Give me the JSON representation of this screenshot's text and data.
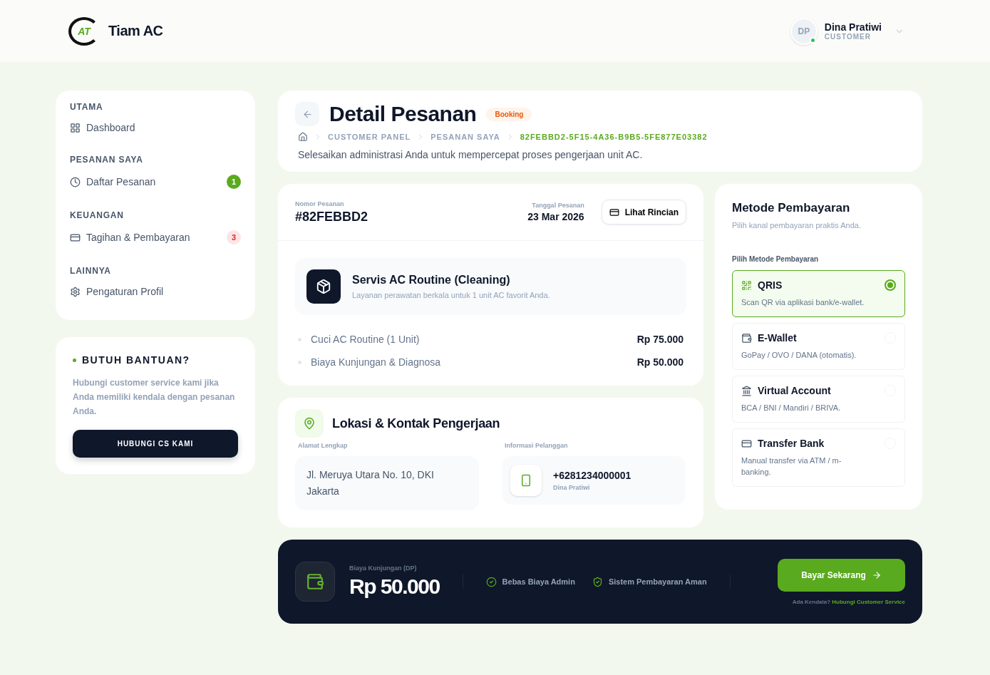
{
  "header": {
    "logo_text": "AT",
    "brand": "Tiam AC",
    "user": {
      "initials": "DP",
      "name": "Dina Pratiwi",
      "role": "CUSTOMER",
      "online": true
    }
  },
  "sidebar": {
    "sections": [
      {
        "title": "UTAMA",
        "items": [
          {
            "label": "Dashboard"
          }
        ]
      },
      {
        "title": "PESANAN SAYA",
        "items": [
          {
            "label": "Daftar Pesanan",
            "badge": "1",
            "color": "#5aaa1f"
          }
        ]
      },
      {
        "title": "KEUANGAN",
        "items": [
          {
            "label": "Tagihan & Pembayaran",
            "badge": "3",
            "color": "#fde4e4"
          }
        ]
      },
      {
        "title": "LAINNYA",
        "items": [
          {
            "label": "Pengaturan Profil"
          }
        ]
      }
    ]
  },
  "help": {
    "title": "BUTUH BANTUAN?",
    "text": "Hubungi customer service kami jika Anda memiliki kendala dengan pesanan Anda.",
    "button": "HUBUNGI CS KAMI"
  },
  "page": {
    "title": "Detail Pesanan",
    "status": "Booking",
    "breadcrumb": [
      "CUSTOMER PANEL",
      "PESANAN SAYA",
      "82FEBBD2-5F15-4A36-B9B5-5FE877E03382"
    ],
    "subtitle": "Selesaikan administrasi Anda untuk mempercepat proses pengerjaan unit AC."
  },
  "order": {
    "number_label": "Nomor Pesanan",
    "number": "#82FEBBD2",
    "date_label": "Tanggal Pesanan",
    "date": "23 Mar 2026",
    "details_button": "Lihat Rincian",
    "service": {
      "name": "Servis AC Routine (Cleaning)",
      "description": "Layanan perawatan berkala untuk 1 unit AC favorit Anda."
    },
    "lines": [
      {
        "label": "Cuci AC Routine (1 Unit)",
        "price": "Rp 75.000"
      },
      {
        "label": "Biaya Kunjungan & Diagnosa",
        "price": "Rp 50.000"
      }
    ]
  },
  "location": {
    "title": "Lokasi & Kontak Pengerjaan",
    "address_label": "Alamat Lengkap",
    "address": "Jl. Meruya Utara No. 10, DKI Jakarta",
    "contact_label": "Informasi Pelanggan",
    "phone": "+6281234000001",
    "customer": "Dina Pratiwi"
  },
  "payment": {
    "title": "Metode Pembayaran",
    "subtitle": "Pilih kanal pembayaran praktis Anda.",
    "label": "Pilih Metode Pembayaran",
    "methods": [
      {
        "name": "QRIS",
        "description": "Scan QR via aplikasi bank/e-wallet.",
        "selected": true
      },
      {
        "name": "E-Wallet",
        "description": "GoPay / OVO / DANA (otomatis).",
        "selected": false
      },
      {
        "name": "Virtual Account",
        "description": "BCA / BNI / Mandiri / BRIVA.",
        "selected": false
      },
      {
        "name": "Transfer Bank",
        "description": "Manual transfer via ATM / m-banking.",
        "selected": false
      }
    ]
  },
  "footer": {
    "amount_label": "Biaya Kunjungan (DP)",
    "amount": "Rp 50.000",
    "features": [
      "Bebas Biaya Admin",
      "Sistem Pembayaran Aman"
    ],
    "pay_button": "Bayar Sekarang",
    "help_prefix": "Ada Kendala?",
    "help_link": "Hubungi Customer Service"
  }
}
